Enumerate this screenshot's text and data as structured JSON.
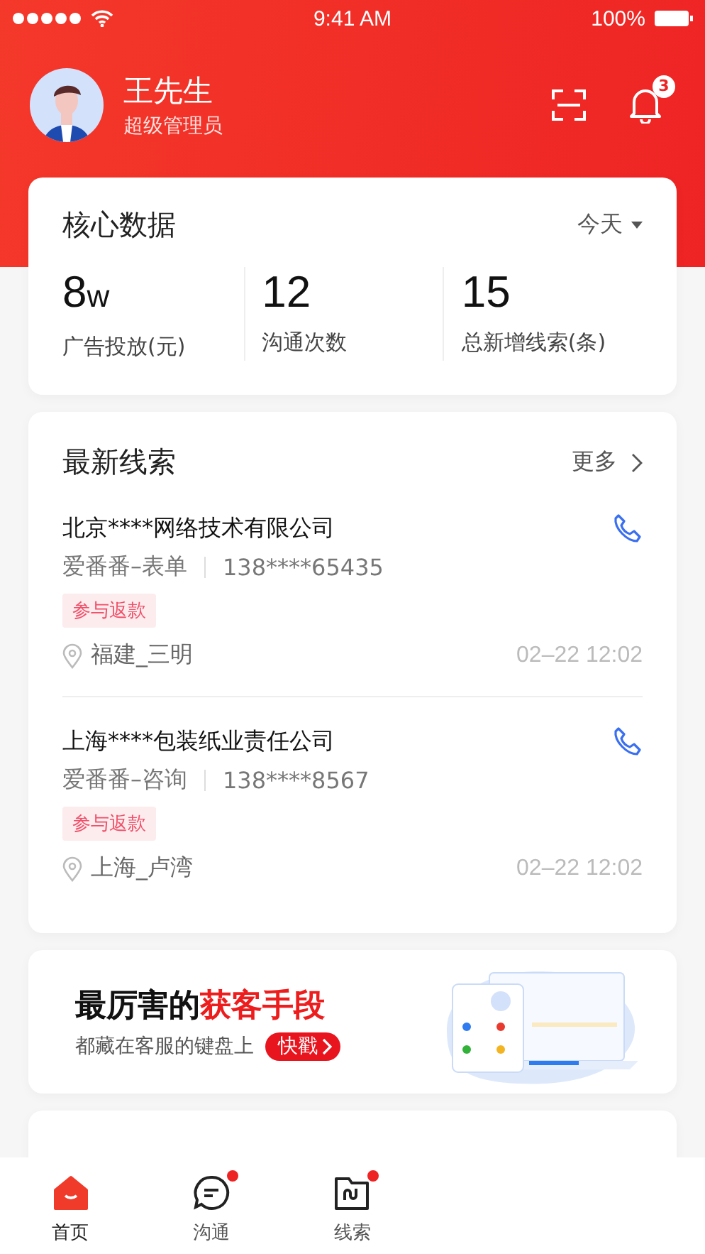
{
  "status_bar": {
    "time": "9:41 AM",
    "battery": "100%"
  },
  "profile": {
    "name": "王先生",
    "role": "超级管理员",
    "notification_count": "3"
  },
  "core_data": {
    "title": "核心数据",
    "period": "今天",
    "stats": [
      {
        "value": "8",
        "unit": "w",
        "label": "广告投放(元)"
      },
      {
        "value": "12",
        "label": "沟通次数"
      },
      {
        "value": "15",
        "label": "总新增线索(条)"
      }
    ]
  },
  "latest_leads": {
    "title": "最新线索",
    "more": "更多",
    "leads": [
      {
        "company": "北京****网络技术有限公司",
        "source": "爱番番–表单",
        "phone": "138****65435",
        "tag": "参与返款",
        "location": "福建_三明",
        "time": "02–22 12:02"
      },
      {
        "company": "上海****包装纸业责任公司",
        "source": "爱番番–咨询",
        "phone": "138****8567",
        "tag": "参与返款",
        "location": "上海_卢湾",
        "time": "02–22 12:02"
      }
    ]
  },
  "banner": {
    "title": "最厉害的**获客手段**",
    "subtitle": "都藏在客服的键盘上",
    "button": "快戳"
  },
  "tab_bar": [
    {
      "label": "首页",
      "selected": true,
      "dot": false
    },
    {
      "label": "沟通",
      "selected": false,
      "dot": true
    },
    {
      "label": "线索",
      "selected": false,
      "dot": true
    }
  ]
}
